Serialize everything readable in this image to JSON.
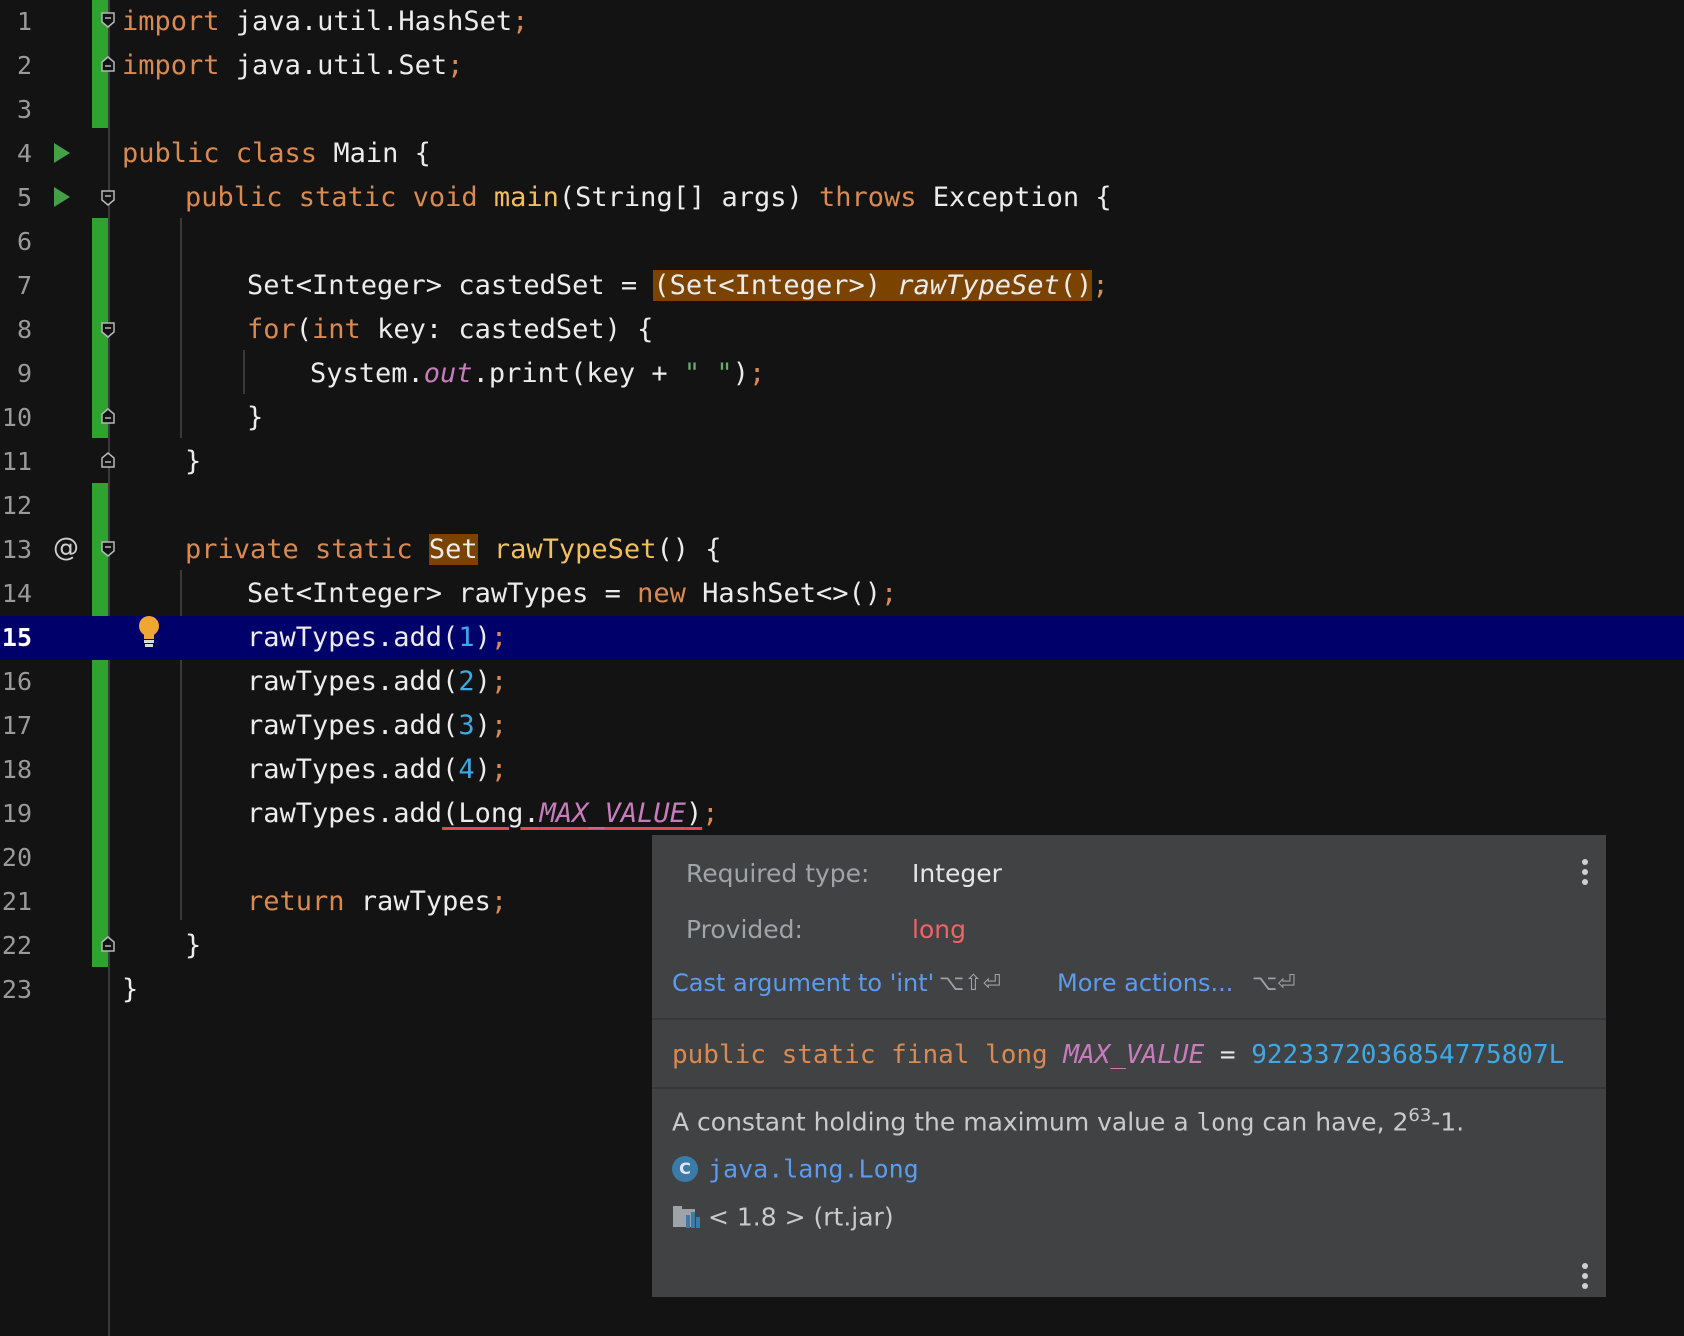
{
  "editor": {
    "current_line": 15,
    "lines": [
      {
        "n": "1"
      },
      {
        "n": "2"
      },
      {
        "n": "3"
      },
      {
        "n": "4"
      },
      {
        "n": "5"
      },
      {
        "n": "6"
      },
      {
        "n": "7"
      },
      {
        "n": "8"
      },
      {
        "n": "9"
      },
      {
        "n": "10"
      },
      {
        "n": "11"
      },
      {
        "n": "12"
      },
      {
        "n": "13"
      },
      {
        "n": "14"
      },
      {
        "n": "15"
      },
      {
        "n": "16"
      },
      {
        "n": "17"
      },
      {
        "n": "18"
      },
      {
        "n": "19"
      },
      {
        "n": "20"
      },
      {
        "n": "21"
      },
      {
        "n": "22"
      },
      {
        "n": "23"
      }
    ],
    "code": {
      "l1": {
        "kw": "import",
        "rest": " java.util.HashSet",
        "semi": ";"
      },
      "l2": {
        "kw": "import",
        "rest": " java.util.Set",
        "semi": ";"
      },
      "l4": {
        "kw": "public class",
        "rest": " Main {"
      },
      "l5": {
        "kw1": "public static void",
        "fn": "main",
        "mid": "(String[] args) ",
        "kw2": "throws",
        "rest": " Exception {"
      },
      "l7": {
        "pre": "Set<Integer> castedSet = ",
        "cast": "(Set<Integer>) ",
        "call": "rawTypeSet",
        "paren": "()",
        "semi": ";"
      },
      "l8": {
        "kw1": "for",
        "p": "(",
        "kw2": "int",
        "rest": " key: castedSet) {"
      },
      "l9": {
        "pre": "System.",
        "fld": "out",
        "mid": ".print(key + ",
        "str": "\" \"",
        "post": ")",
        "semi": ";"
      },
      "l10": {
        "text": "}"
      },
      "l11": {
        "text": "}"
      },
      "l13": {
        "kw": "private static",
        "sp": " ",
        "type": "Set",
        "sp2": " ",
        "fn": "rawTypeSet",
        "rest": "() {"
      },
      "l14": {
        "pre": "Set<Integer> rawTypes = ",
        "kw": "new",
        "rest": " HashSet<>()",
        "semi": ";"
      },
      "l15": {
        "pre": "rawTypes.add(",
        "num": "1",
        "post": ")",
        "semi": ";"
      },
      "l16": {
        "pre": "rawTypes.add(",
        "num": "2",
        "post": ")",
        "semi": ";"
      },
      "l17": {
        "pre": "rawTypes.add(",
        "num": "3",
        "post": ")",
        "semi": ";"
      },
      "l18": {
        "pre": "rawTypes.add(",
        "num": "4",
        "post": ")",
        "semi": ";"
      },
      "l19": {
        "pre": "rawTypes.add",
        "err_a": "(Long.",
        "err_fld": "MAX_VALUE",
        "err_b": ")",
        "semi": ";"
      },
      "l21": {
        "kw": "return",
        "rest": " rawTypes",
        "semi": ";"
      },
      "l22": {
        "text": "}"
      },
      "l23": {
        "text": "}"
      }
    },
    "gutter_icons": {
      "run": "run-icon",
      "at": "@",
      "fold": "fold-icon",
      "bulb": "lightbulb-icon"
    }
  },
  "popup": {
    "required_label": "Required type:",
    "required_value": "Integer",
    "provided_label": "Provided:",
    "provided_value": "long",
    "cast_action": "Cast argument to 'int'",
    "cast_shortcut": "⌥⇧⏎",
    "more_actions": "More actions...",
    "more_shortcut": "⌥⏎",
    "sig_kw": "public static final long",
    "sig_field": "MAX_VALUE",
    "sig_eq": " = ",
    "sig_value": "9223372036854775807L",
    "desc_a": "A constant holding the maximum value a ",
    "desc_code": "long",
    "desc_b": " can have, 2",
    "desc_sup": "63",
    "desc_c": "-1.",
    "class_icon": "C",
    "class_name": "java.lang.Long",
    "library": "< 1.8 > (rt.jar)",
    "colors": {
      "bg": "#404244",
      "link": "#5b9bf0",
      "error": "#ef6464"
    }
  }
}
